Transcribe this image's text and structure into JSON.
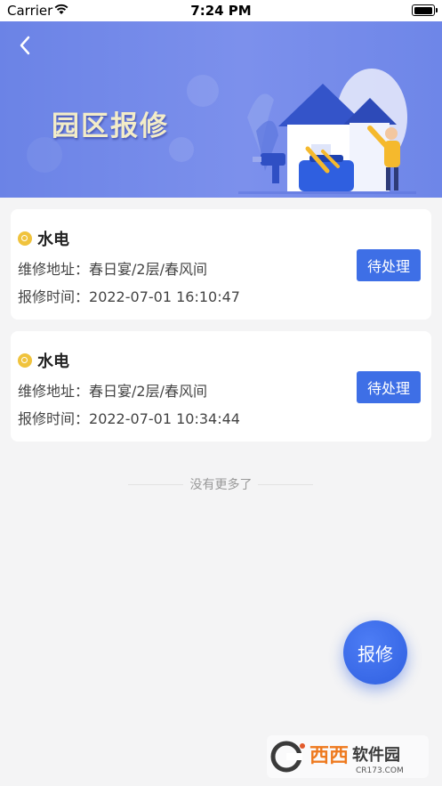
{
  "status_bar": {
    "carrier": "Carrier",
    "time": "7:24 PM"
  },
  "banner": {
    "title": "园区报修"
  },
  "repairs": [
    {
      "category": "水电",
      "address_label": "维修地址：",
      "address": "春日宴/2层/春风间",
      "time_label": "报修时间：",
      "time": "2022-07-01 16:10:47",
      "status": "待处理"
    },
    {
      "category": "水电",
      "address_label": "维修地址：",
      "address": "春日宴/2层/春风间",
      "time_label": "报修时间：",
      "time": "2022-07-01 10:34:44",
      "status": "待处理"
    }
  ],
  "list_footer": "没有更多了",
  "fab_label": "报修",
  "watermark": {
    "brand": "西西软件园",
    "domain": "CR173.COM"
  },
  "colors": {
    "primary": "#3e6fe6",
    "banner": "#7089ea",
    "category_icon": "#f0c33d"
  }
}
